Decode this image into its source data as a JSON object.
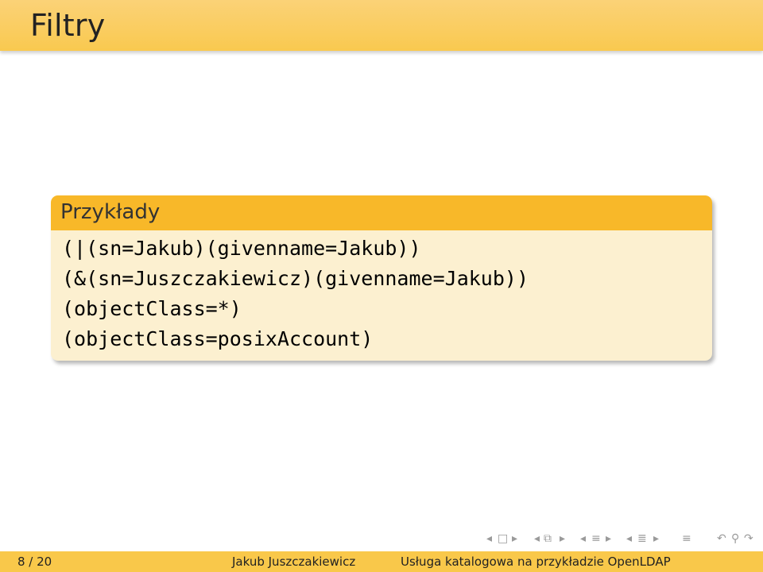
{
  "slide": {
    "title": "Filtry"
  },
  "block": {
    "title": "Przykłady",
    "lines": [
      "(|(sn=Jakub)(givenname=Jakub))",
      "(&(sn=Juszczakiewicz)(givenname=Jakub))",
      "(objectClass=*)",
      "(objectClass=posixAccount)"
    ]
  },
  "footer": {
    "page": "8 / 20",
    "author": "Jakub Juszczakiewicz",
    "talk_title": "Usługa katalogowa na przykładzie OpenLDAP"
  },
  "colors": {
    "title_bar": "#f9c94f",
    "block_header": "#f8b829",
    "block_body": "#fcf0d0",
    "footer": "#f9c84a"
  },
  "nav_icons": [
    "nav-left-icon",
    "frame-icon",
    "nav-right-icon",
    "nav-left-icon",
    "subsection-icon",
    "nav-right-icon",
    "nav-left-icon",
    "section-icon",
    "nav-right-icon",
    "nav-left-icon",
    "section-list-icon",
    "nav-right-icon",
    "align-icon",
    "undo-icon",
    "zoom-icon",
    "redo-icon"
  ]
}
